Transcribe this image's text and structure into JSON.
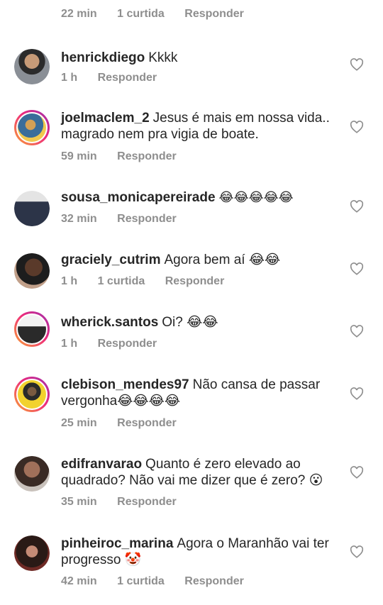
{
  "top_meta": {
    "time": "22 min",
    "likes": "1 curtida",
    "reply": "Responder"
  },
  "comments": [
    {
      "username": "henrickdiego",
      "text": "Kkkk",
      "time": "1 h",
      "likes": "",
      "reply": "Responder"
    },
    {
      "username": "joelmaclem_2",
      "text": "Jesus é mais em nossa vida.. magrado nem pra vigia de boate.",
      "time": "59 min",
      "likes": "",
      "reply": "Responder"
    },
    {
      "username": "sousa_monicapereirade",
      "text": "😂😂😂😂😂",
      "time": "32 min",
      "likes": "",
      "reply": "Responder"
    },
    {
      "username": "graciely_cutrim",
      "text": "Agora bem aí 😂😂",
      "time": "1 h",
      "likes": "1 curtida",
      "reply": "Responder"
    },
    {
      "username": "wherick.santos",
      "text": "Oi? 😂😂",
      "time": "1 h",
      "likes": "",
      "reply": "Responder"
    },
    {
      "username": "clebison_mendes97",
      "text": "Não cansa de passar vergonha😂😂😂😂",
      "time": "25 min",
      "likes": "",
      "reply": "Responder"
    },
    {
      "username": "edifranvarao",
      "text": "Quanto é zero elevado ao quadrado? Não vai me dizer que é zero? 😮",
      "time": "35 min",
      "likes": "",
      "reply": "Responder"
    },
    {
      "username": "pinheiroc_marina",
      "text": "Agora o Maranhão vai ter progresso 🤡",
      "time": "42 min",
      "likes": "1 curtida",
      "reply": "Responder"
    }
  ],
  "icons": {
    "like": "heart-outline-icon"
  },
  "colors": {
    "text": "#262626",
    "meta": "#8e8e8e",
    "ring_start": "#f9a533",
    "ring_end": "#9b2fae"
  }
}
